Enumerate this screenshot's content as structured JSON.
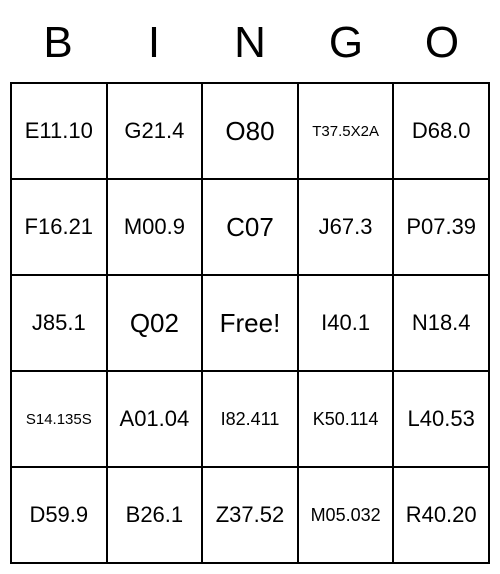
{
  "header": [
    "B",
    "I",
    "N",
    "G",
    "O"
  ],
  "cells": [
    [
      {
        "value": "E11.10",
        "size": "md"
      },
      {
        "value": "G21.4",
        "size": "md"
      },
      {
        "value": "O80",
        "size": "lg"
      },
      {
        "value": "T37.5X2A",
        "size": "xs"
      },
      {
        "value": "D68.0",
        "size": "md"
      }
    ],
    [
      {
        "value": "F16.21",
        "size": "md"
      },
      {
        "value": "M00.9",
        "size": "md"
      },
      {
        "value": "C07",
        "size": "lg"
      },
      {
        "value": "J67.3",
        "size": "md"
      },
      {
        "value": "P07.39",
        "size": "md"
      }
    ],
    [
      {
        "value": "J85.1",
        "size": "md"
      },
      {
        "value": "Q02",
        "size": "lg"
      },
      {
        "value": "Free!",
        "size": "lg"
      },
      {
        "value": "I40.1",
        "size": "md"
      },
      {
        "value": "N18.4",
        "size": "md"
      }
    ],
    [
      {
        "value": "S14.135S",
        "size": "xs"
      },
      {
        "value": "A01.04",
        "size": "md"
      },
      {
        "value": "I82.411",
        "size": "sm"
      },
      {
        "value": "K50.114",
        "size": "sm"
      },
      {
        "value": "L40.53",
        "size": "md"
      }
    ],
    [
      {
        "value": "D59.9",
        "size": "md"
      },
      {
        "value": "B26.1",
        "size": "md"
      },
      {
        "value": "Z37.52",
        "size": "md"
      },
      {
        "value": "M05.032",
        "size": "sm"
      },
      {
        "value": "R40.20",
        "size": "md"
      }
    ]
  ]
}
